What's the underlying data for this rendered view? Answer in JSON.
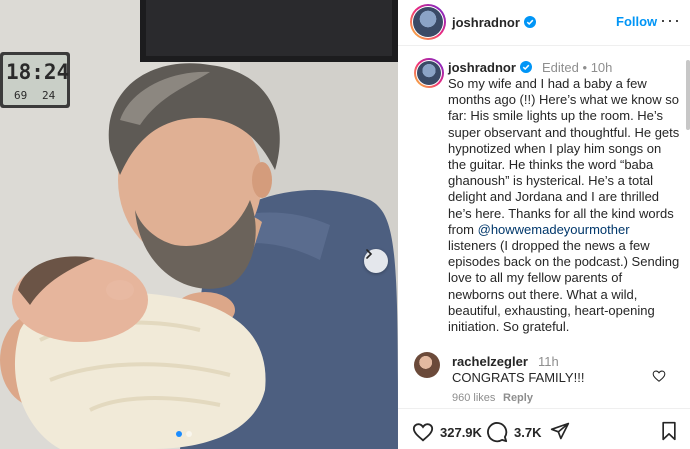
{
  "post": {
    "username": "joshradnor",
    "follow_label": "Follow",
    "more_label": "···"
  },
  "clock": {
    "time": "18:24",
    "temp": "69",
    "humidity": "24"
  },
  "caption": {
    "username": "joshradnor",
    "edited": "Edited",
    "separator": "•",
    "time": "10h",
    "text_before": "So my wife and I had a baby a few months ago (!!) Here’s what we know so far: His smile lights up the room. He’s super observant and thoughtful. He gets hypnotized when I play him songs on the guitar. He thinks the word “baba ghanoush” is hysterical. He’s a total delight and Jordana and I are thrilled he’s here. Thanks for all the kind words from ",
    "mention": "@howwemadeyourmother",
    "text_after": " listeners (I dropped the news a few episodes back on the podcast.) Sending love to all my fellow parents of newborns out there. What a wild, beautiful, exhausting, heart-opening initiation. So grateful."
  },
  "comment": {
    "username": "rachelzegler",
    "time": "11h",
    "text": "CONGRATS FAMILY!!!",
    "likes": "960 likes",
    "reply_label": "Reply"
  },
  "actions": {
    "likes": "327.9K",
    "comments": "3.7K"
  },
  "icons": {
    "verified": "verified-badge-icon",
    "heart": "heart-icon",
    "comment": "comment-icon",
    "share": "share-icon",
    "bookmark": "bookmark-icon",
    "next": "chevron-right-icon"
  },
  "colors": {
    "link": "#0095f6",
    "mention": "#00376b",
    "muted": "#8e8e8e"
  }
}
